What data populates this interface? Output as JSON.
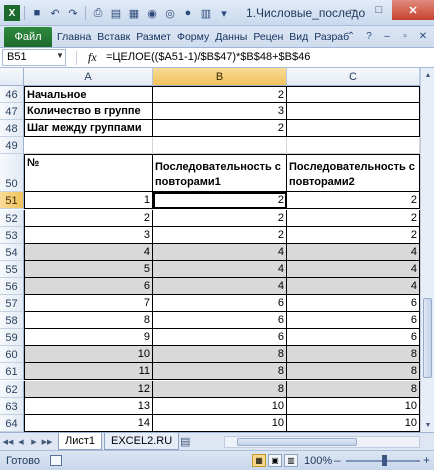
{
  "window": {
    "title": "1.Числовые_последо",
    "controls": {
      "minimize": "–",
      "maximize": "□",
      "close": "✕"
    }
  },
  "quick_access": {
    "save": "💾",
    "undo": "↶",
    "redo": "↷"
  },
  "ribbon": {
    "file_tab": "Файл",
    "tabs": [
      "Главна",
      "Вставк",
      "Размет",
      "Форму",
      "Данны",
      "Рецен",
      "Вид",
      "Разраб"
    ]
  },
  "formula_bar": {
    "name_box": "B51",
    "fx": "fx",
    "formula": "=ЦЕЛОЕ(($A51-1)/$B$47)*$B$48+$B$46"
  },
  "columns": [
    "A",
    "B",
    "C"
  ],
  "rows": [
    {
      "num": "46",
      "a": "Начальное",
      "b": "2",
      "c": ""
    },
    {
      "num": "47",
      "a": "Количество в группе",
      "b": "3",
      "c": ""
    },
    {
      "num": "48",
      "a": "Шаг между группами",
      "b": "2",
      "c": ""
    },
    {
      "num": "49",
      "a": "",
      "b": "",
      "c": ""
    },
    {
      "num": "50",
      "a": "№",
      "b": "Последовательность с повторами1",
      "c": "Последовательность с повторами2"
    },
    {
      "num": "51",
      "a": "1",
      "b": "2",
      "c": "2"
    },
    {
      "num": "52",
      "a": "2",
      "b": "2",
      "c": "2"
    },
    {
      "num": "53",
      "a": "3",
      "b": "2",
      "c": "2"
    },
    {
      "num": "54",
      "a": "4",
      "b": "4",
      "c": "4"
    },
    {
      "num": "55",
      "a": "5",
      "b": "4",
      "c": "4"
    },
    {
      "num": "56",
      "a": "6",
      "b": "4",
      "c": "4"
    },
    {
      "num": "57",
      "a": "7",
      "b": "6",
      "c": "6"
    },
    {
      "num": "58",
      "a": "8",
      "b": "6",
      "c": "6"
    },
    {
      "num": "59",
      "a": "9",
      "b": "6",
      "c": "6"
    },
    {
      "num": "60",
      "a": "10",
      "b": "8",
      "c": "8"
    },
    {
      "num": "61",
      "a": "11",
      "b": "8",
      "c": "8"
    },
    {
      "num": "62",
      "a": "12",
      "b": "8",
      "c": "8"
    },
    {
      "num": "63",
      "a": "13",
      "b": "10",
      "c": "10"
    },
    {
      "num": "64",
      "a": "14",
      "b": "10",
      "c": "10"
    },
    {
      "num": "65",
      "a": "15",
      "b": "10",
      "c": "10"
    }
  ],
  "sheets": {
    "nav": [
      "◀◀",
      "◀",
      "▶",
      "▶▶"
    ],
    "tabs": [
      "Лист1",
      "EXCEL2.RU"
    ]
  },
  "status": {
    "ready": "Готово",
    "zoom": "100%",
    "zoom_minus": "–",
    "zoom_plus": "+"
  },
  "colors": {
    "file_tab": "#1d6b2c",
    "selected_header": "#f0c25a",
    "gray_band": "#d9d9d9"
  }
}
